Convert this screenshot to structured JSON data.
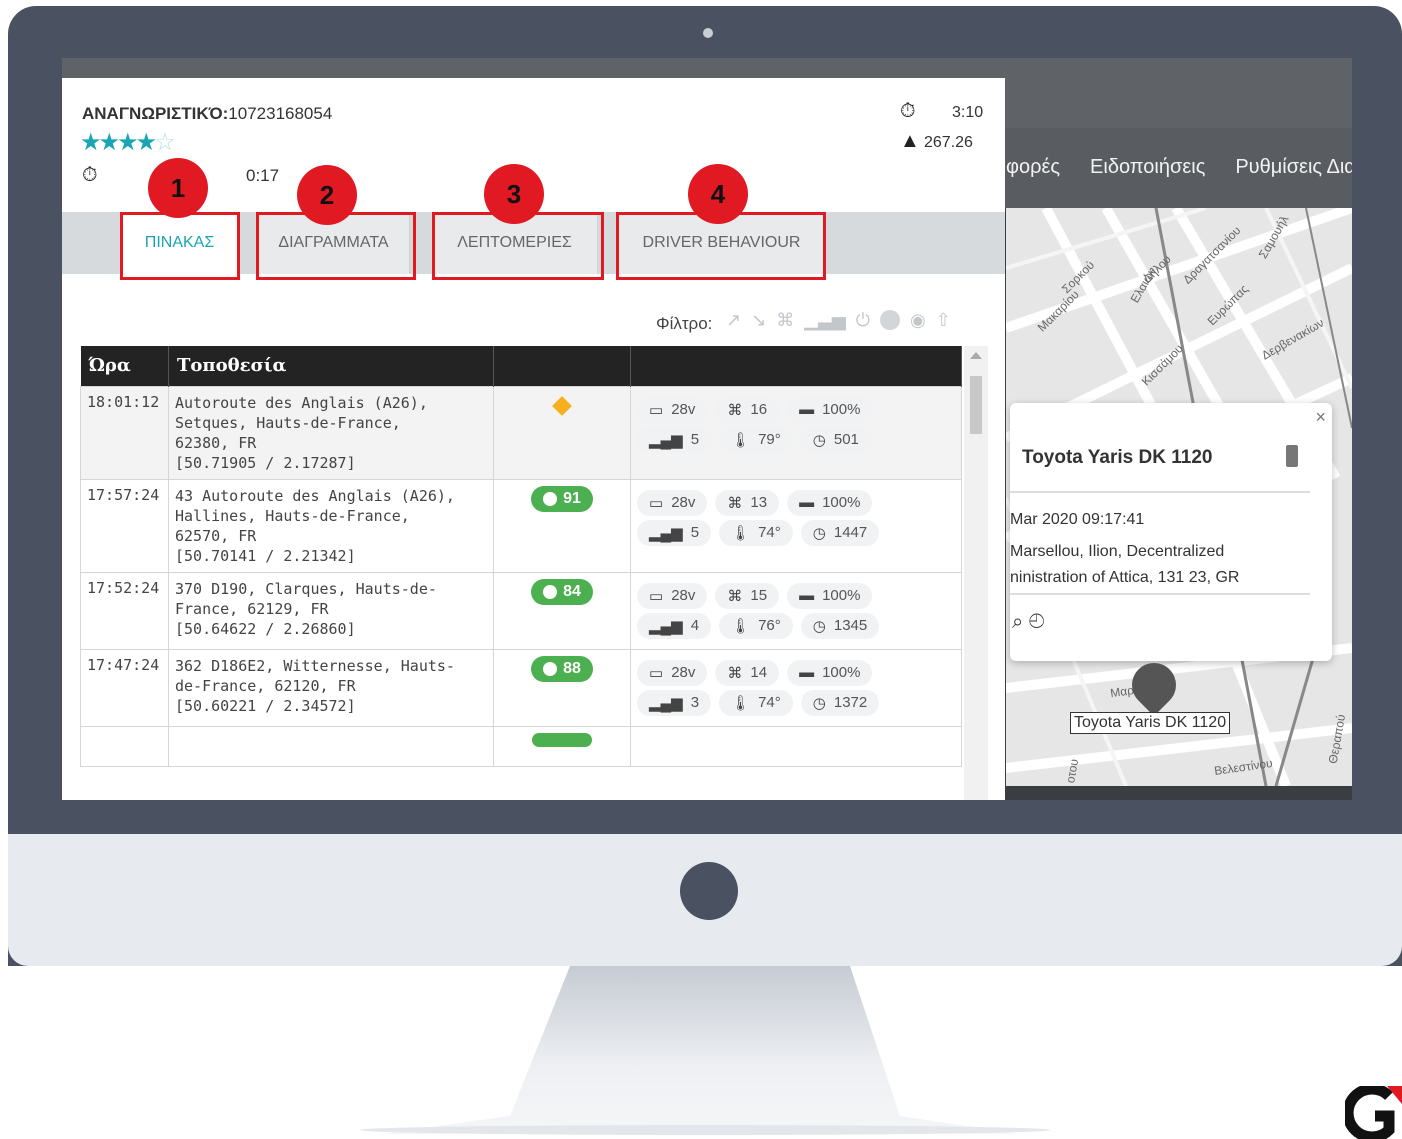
{
  "panel": {
    "id_label": "ΑΝΑΓΝΩΡΙΣΤΙΚΌ:",
    "id_value": "10723168054",
    "rating_stars": 4.5,
    "trip_duration": "0:17",
    "right_time": "3:10",
    "right_distance": "267.26",
    "tabs": [
      "ΠΙΝΑΚΑΣ",
      "ΔΙΑΓΡΑΜΜΑΤΑ",
      "ΛΕΠΤΟΜΕΡΙΕΣ",
      "DRIVER BEHAVIOUR"
    ],
    "active_tab": "ΠΙΝΑΚΑΣ",
    "filter_label": "Φίλτρο:",
    "table": {
      "headers": [
        "Ώρα",
        "Τοποθεσία",
        "",
        ""
      ],
      "rows": [
        {
          "time": "18:01:12",
          "loc1": "Autoroute des Anglais (A26),",
          "loc2": "Setques, Hauts-de-France,",
          "loc3": "62380, FR",
          "coords": "[50.71905 / 2.17287]",
          "speed": "",
          "volt": "28v",
          "sat": "16",
          "battery": "100%",
          "signal": "5",
          "temp": "79°",
          "odo": "501"
        },
        {
          "time": "17:57:24",
          "loc1": "43 Autoroute des Anglais (A26),",
          "loc2": "Hallines, Hauts-de-France,",
          "loc3": "62570, FR",
          "coords": "[50.70141 / 2.21342]",
          "speed": "91",
          "volt": "28v",
          "sat": "13",
          "battery": "100%",
          "signal": "5",
          "temp": "74°",
          "odo": "1447"
        },
        {
          "time": "17:52:24",
          "loc1": "370 D190, Clarques, Hauts-de-",
          "loc2": "France, 62129, FR",
          "loc3": "",
          "coords": "[50.64622 / 2.26860]",
          "speed": "84",
          "volt": "28v",
          "sat": "15",
          "battery": "100%",
          "signal": "4",
          "temp": "76°",
          "odo": "1345"
        },
        {
          "time": "17:47:24",
          "loc1": "362 D186E2, Witternesse, Hauts-",
          "loc2": "de-France, 62120, FR",
          "loc3": "",
          "coords": "[50.60221 / 2.34572]",
          "speed": "88",
          "volt": "28v",
          "sat": "14",
          "battery": "100%",
          "signal": "3",
          "temp": "74°",
          "odo": "1372"
        }
      ]
    }
  },
  "nav": {
    "items": [
      "φορές",
      "Ειδοποιήσεις",
      "Ρυθμίσεις Διαχε"
    ]
  },
  "map": {
    "streets": [
      "Ελαιών",
      "Δήλου",
      "Δραγατσανίου",
      "Σαμουήλ",
      "Σορκού",
      "Μακαρίου",
      "Κισσάμου",
      "Ευρώπας",
      "Δερβενακίων",
      "Μαρσέλλου",
      "Βελεστίνου",
      "Θεραπού",
      "οτου"
    ],
    "popup": {
      "title": "Toyota Yaris DK 1120",
      "date": "Mar 2020 09:17:41",
      "address_line1": "Marsellou, Ilion, Decentralized",
      "address_line2": "ninistration of Attica, 131 23, GR",
      "close": "×"
    },
    "marker_label": "Toyota Yaris DK 1120"
  },
  "annotations": [
    "1",
    "2",
    "3",
    "4"
  ],
  "colors": {
    "accent": "#1aa5b4",
    "annotation": "#e01923",
    "speed_badge": "#4caf50",
    "bezel": "#4a5261"
  }
}
